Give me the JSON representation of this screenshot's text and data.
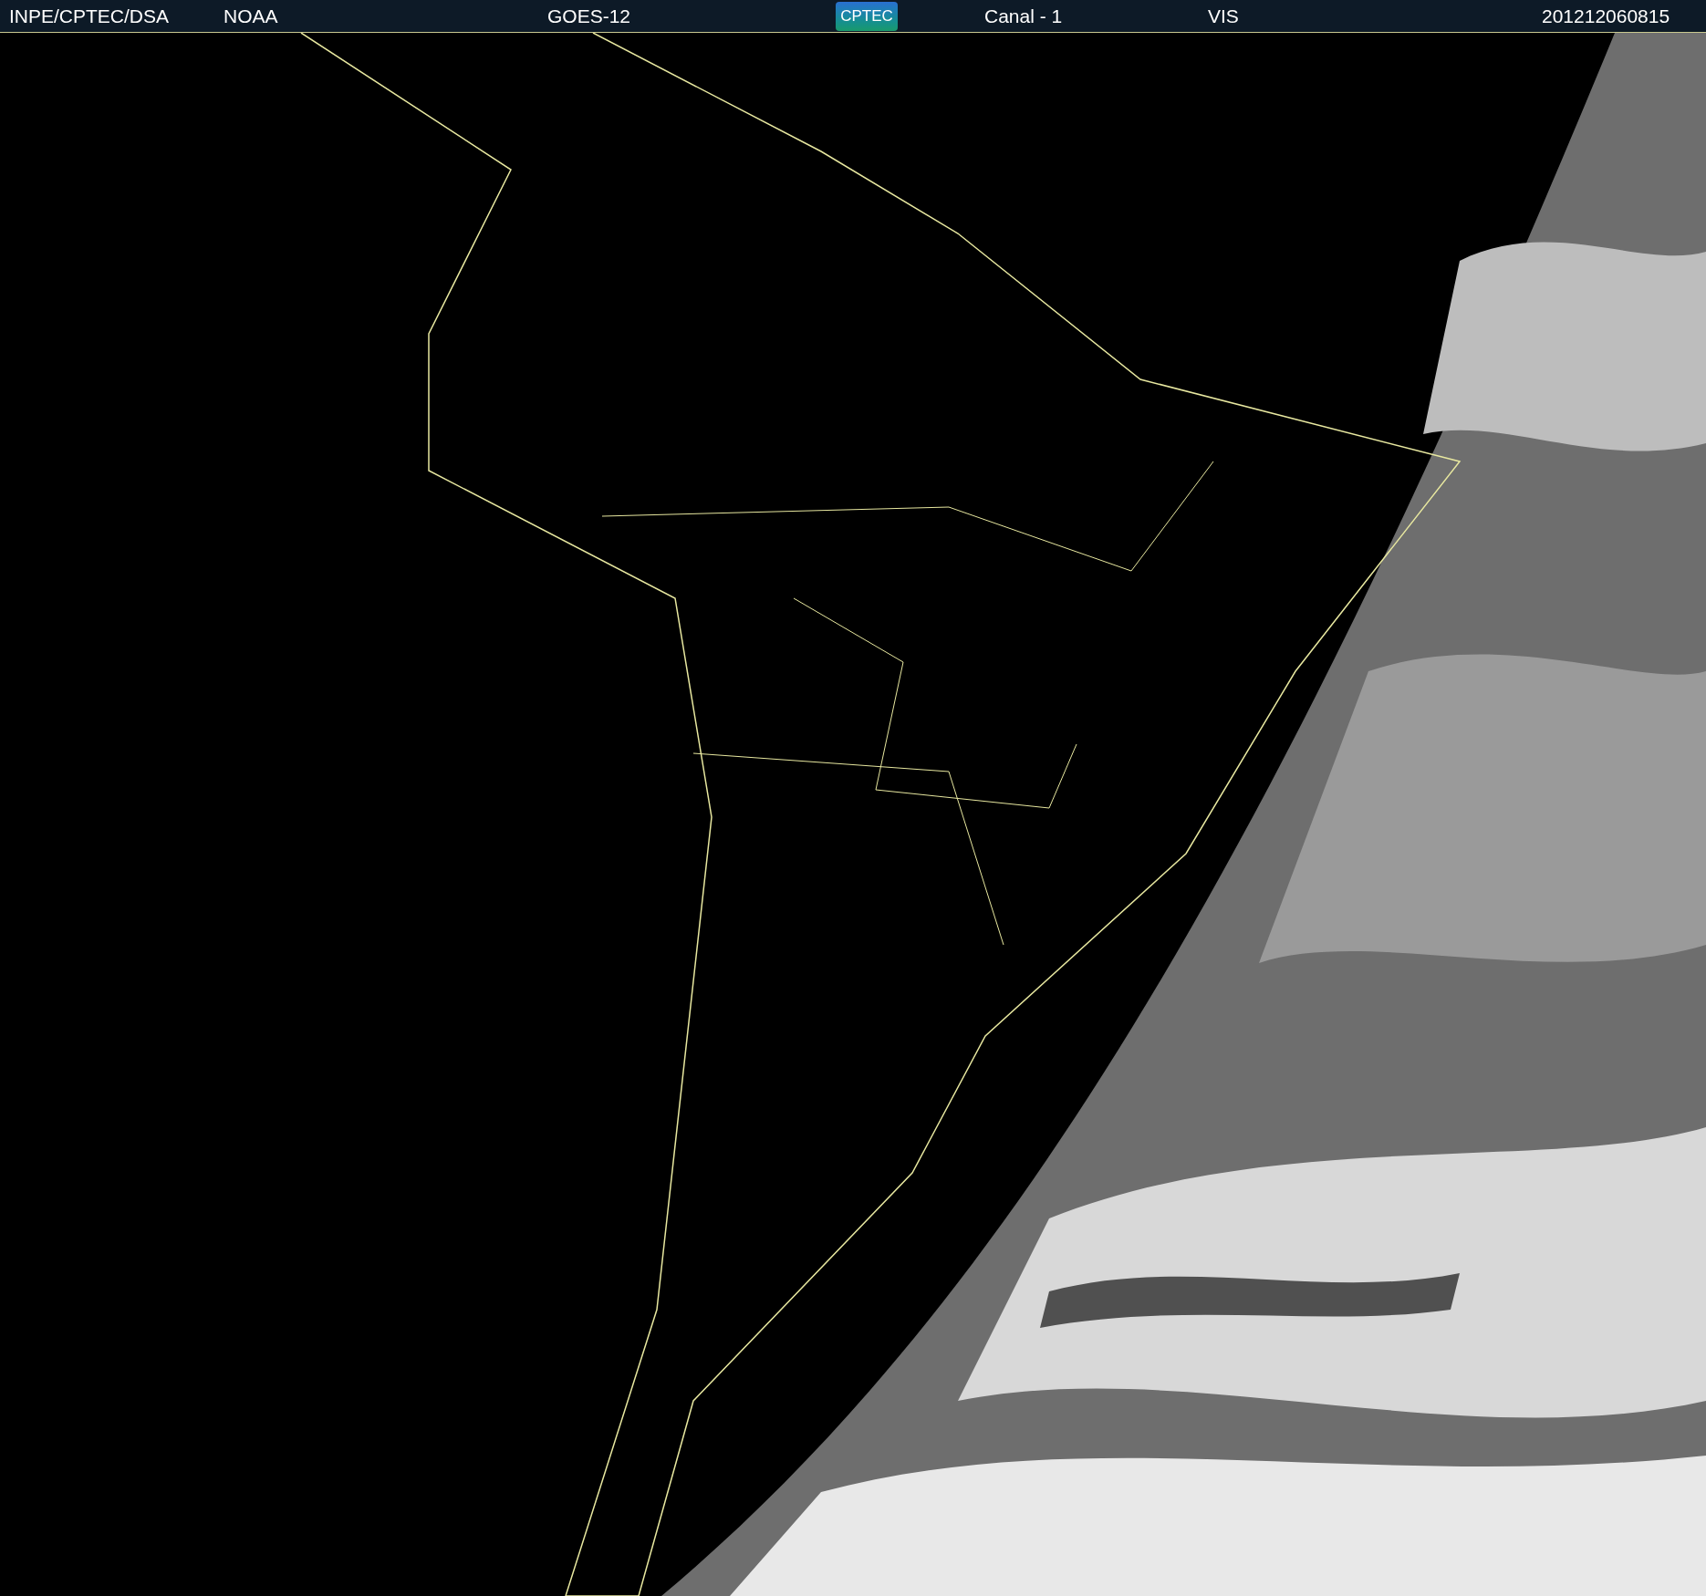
{
  "header": {
    "source": "INPE/CPTEC/DSA",
    "agency": "NOAA",
    "satellite": "GOES-12",
    "logo": "CPTEC",
    "channel": "Canal - 1",
    "band": "VIS",
    "timestamp": "201212060815"
  }
}
